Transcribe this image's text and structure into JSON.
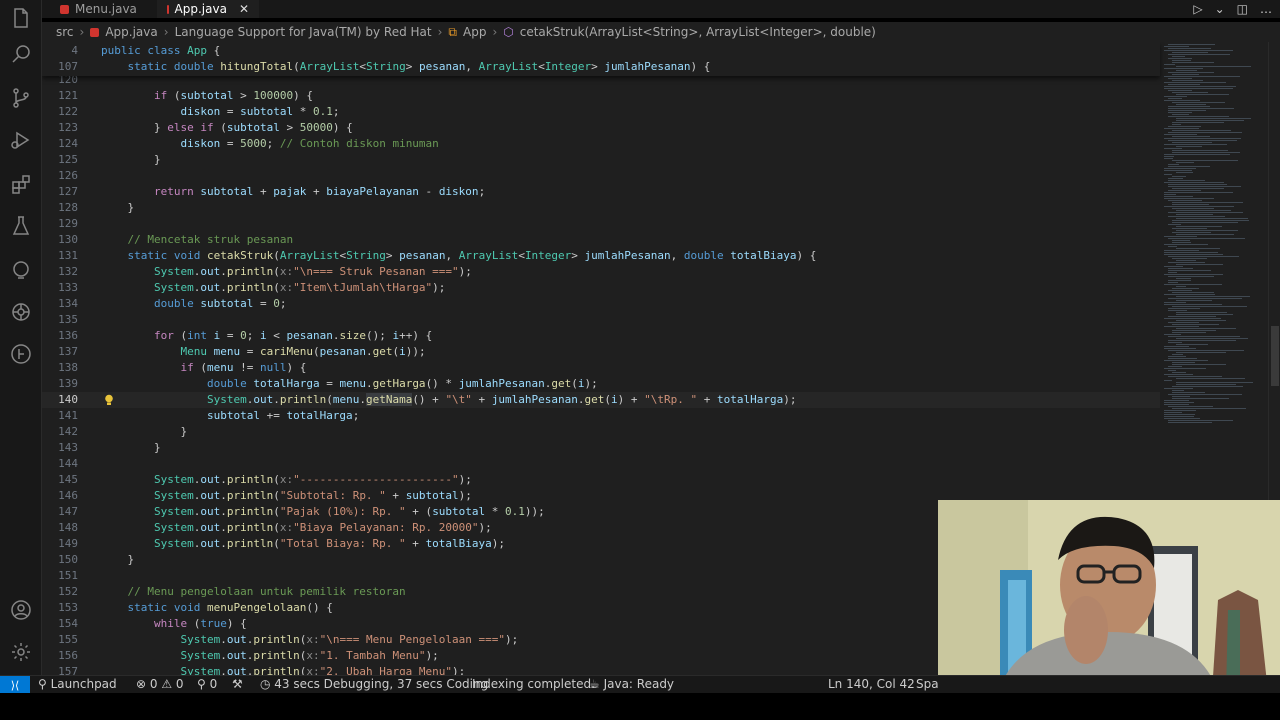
{
  "tabs": [
    {
      "label": "Menu.java"
    },
    {
      "label": "App.java",
      "close": "✕"
    }
  ],
  "breadcrumb": [
    "src",
    "App.java",
    "Language Support for Java(TM) by Red Hat",
    "App",
    "cetakStruk(ArrayList<String>, ArrayList<Integer>, double)"
  ],
  "sticky": [
    {
      "n": "4",
      "html": "<span class='kw'>public</span> <span class='kw'>class</span> <span class='ty'>App</span> {"
    },
    {
      "n": "107",
      "html": "    <span class='kw'>static</span> <span class='kw'>double</span> <span class='fn'>hitungTotal</span>(<span class='ty'>ArrayList</span>&lt;<span class='ty'>String</span>&gt; <span class='par'>pesanan</span>, <span class='ty'>ArrayList</span>&lt;<span class='ty'>Integer</span>&gt; <span class='par'>jumlahPesanan</span>) {"
    }
  ],
  "lines": [
    {
      "n": "120",
      "html": ""
    },
    {
      "n": "121",
      "html": "        <span class='ctl'>if</span> (<span class='par'>subtotal</span> &gt; <span class='num'>100000</span>) {"
    },
    {
      "n": "122",
      "html": "            <span class='par'>diskon</span> = <span class='par'>subtotal</span> * <span class='num'>0.1</span>;"
    },
    {
      "n": "123",
      "html": "        } <span class='ctl'>else</span> <span class='ctl'>if</span> (<span class='par'>subtotal</span> &gt; <span class='num'>50000</span>) {"
    },
    {
      "n": "124",
      "html": "            <span class='par'>diskon</span> = <span class='num'>5000</span>; <span class='cm'>// Contoh diskon minuman</span>"
    },
    {
      "n": "125",
      "html": "        }"
    },
    {
      "n": "126",
      "html": ""
    },
    {
      "n": "127",
      "html": "        <span class='ctl'>return</span> <span class='par'>subtotal</span> + <span class='par'>pajak</span> + <span class='par'>biayaPelayanan</span> - <span class='par'>diskon</span>;"
    },
    {
      "n": "128",
      "html": "    }"
    },
    {
      "n": "129",
      "html": ""
    },
    {
      "n": "130",
      "html": "    <span class='cm'>// Mencetak struk pesanan</span>"
    },
    {
      "n": "131",
      "html": "    <span class='kw'>static</span> <span class='kw'>void</span> <span class='fn'>cetakStruk</span>(<span class='ty'>ArrayList</span>&lt;<span class='ty'>String</span>&gt; <span class='par'>pesanan</span>, <span class='ty'>ArrayList</span>&lt;<span class='ty'>Integer</span>&gt; <span class='par'>jumlahPesanan</span>, <span class='kw'>double</span> <span class='par'>totalBiaya</span>) {"
    },
    {
      "n": "132",
      "html": "        <span class='ty'>System</span>.<span class='par'>out</span>.<span class='fn'>println</span>(<span class='hint'>x:</span><span class='str'>\"\\n=== Struk Pesanan ===\"</span>);"
    },
    {
      "n": "133",
      "html": "        <span class='ty'>System</span>.<span class='par'>out</span>.<span class='fn'>println</span>(<span class='hint'>x:</span><span class='str'>\"Item\\tJumlah\\tHarga\"</span>);"
    },
    {
      "n": "134",
      "html": "        <span class='kw'>double</span> <span class='par'>subtotal</span> = <span class='num'>0</span>;"
    },
    {
      "n": "135",
      "html": ""
    },
    {
      "n": "136",
      "html": "        <span class='ctl'>for</span> (<span class='kw'>int</span> <span class='par'>i</span> = <span class='num'>0</span>; <span class='par'>i</span> &lt; <span class='par'>pesanan</span>.<span class='fn'>size</span>(); <span class='par'>i</span>++) {"
    },
    {
      "n": "137",
      "html": "            <span class='ty'>Menu</span> <span class='par'>menu</span> = <span class='fn'>cariMenu</span>(<span class='par'>pesanan</span>.<span class='fn'>get</span>(<span class='par'>i</span>));"
    },
    {
      "n": "138",
      "html": "            <span class='ctl'>if</span> (<span class='par'>menu</span> != <span class='kw'>null</span>) {"
    },
    {
      "n": "139",
      "html": "                <span class='kw'>double</span> <span class='par'>totalHarga</span> = <span class='par'>menu</span>.<span class='fn'>getHarga</span>() * <span class='par'>jumlahPesanan</span>.<span class='fn'>get</span>(<span class='par'>i</span>);"
    },
    {
      "n": "140",
      "html": "                <span class='ty'>System</span>.<span class='par'>out</span>.<span class='fn'>println</span>(<span class='par'>menu</span>.<span class='fn hl'>getNama</span>() + <span class='str'>\"\\t\"</span> + <span class='par'>jumlahPesanan</span>.<span class='fn'>get</span>(<span class='par'>i</span>) + <span class='str'>\"\\tRp. \"</span> + <span class='par'>totalHarga</span>);",
      "current": true
    },
    {
      "n": "141",
      "html": "                <span class='par'>subtotal</span> += <span class='par'>totalHarga</span>;"
    },
    {
      "n": "142",
      "html": "            }"
    },
    {
      "n": "143",
      "html": "        }"
    },
    {
      "n": "144",
      "html": ""
    },
    {
      "n": "145",
      "html": "        <span class='ty'>System</span>.<span class='par'>out</span>.<span class='fn'>println</span>(<span class='hint'>x:</span><span class='str'>\"-----------------------\"</span>);"
    },
    {
      "n": "146",
      "html": "        <span class='ty'>System</span>.<span class='par'>out</span>.<span class='fn'>println</span>(<span class='str'>\"Subtotal: Rp. \"</span> + <span class='par'>subtotal</span>);"
    },
    {
      "n": "147",
      "html": "        <span class='ty'>System</span>.<span class='par'>out</span>.<span class='fn'>println</span>(<span class='str'>\"Pajak (10%): Rp. \"</span> + (<span class='par'>subtotal</span> * <span class='num'>0.1</span>));"
    },
    {
      "n": "148",
      "html": "        <span class='ty'>System</span>.<span class='par'>out</span>.<span class='fn'>println</span>(<span class='hint'>x:</span><span class='str'>\"Biaya Pelayanan: Rp. 20000\"</span>);"
    },
    {
      "n": "149",
      "html": "        <span class='ty'>System</span>.<span class='par'>out</span>.<span class='fn'>println</span>(<span class='str'>\"Total Biaya: Rp. \"</span> + <span class='par'>totalBiaya</span>);"
    },
    {
      "n": "150",
      "html": "    }"
    },
    {
      "n": "151",
      "html": ""
    },
    {
      "n": "152",
      "html": "    <span class='cm'>// Menu pengelolaan untuk pemilik restoran</span>"
    },
    {
      "n": "153",
      "html": "    <span class='kw'>static</span> <span class='kw'>void</span> <span class='fn'>menuPengelolaan</span>() {"
    },
    {
      "n": "154",
      "html": "        <span class='ctl'>while</span> (<span class='kw'>true</span>) {"
    },
    {
      "n": "155",
      "html": "            <span class='ty'>System</span>.<span class='par'>out</span>.<span class='fn'>println</span>(<span class='hint'>x:</span><span class='str'>\"\\n=== Menu Pengelolaan ===\"</span>);"
    },
    {
      "n": "156",
      "html": "            <span class='ty'>System</span>.<span class='par'>out</span>.<span class='fn'>println</span>(<span class='hint'>x:</span><span class='str'>\"1. Tambah Menu\"</span>);"
    },
    {
      "n": "157",
      "html": "            <span class='ty'>System</span>.<span class='par'>out</span>.<span class='fn'>println</span>(<span class='hint'>x:</span><span class='str'>\"2. Ubah Harga Menu\"</span>);"
    }
  ],
  "status": {
    "launchpad": "Launchpad",
    "problems": "⊗ 0 ⚠ 0",
    "ports": "⚲ 0",
    "timer": "43 secs Debugging, 37 secs Coding",
    "indexing": "Indexing completed.",
    "java": "Java: Ready",
    "position": "Ln 140, Col 42",
    "spaces": "Spa"
  },
  "colors": {
    "accent": "#0078d4",
    "editor_bg": "#1f1f1f",
    "java_icon": "#d0352f"
  }
}
